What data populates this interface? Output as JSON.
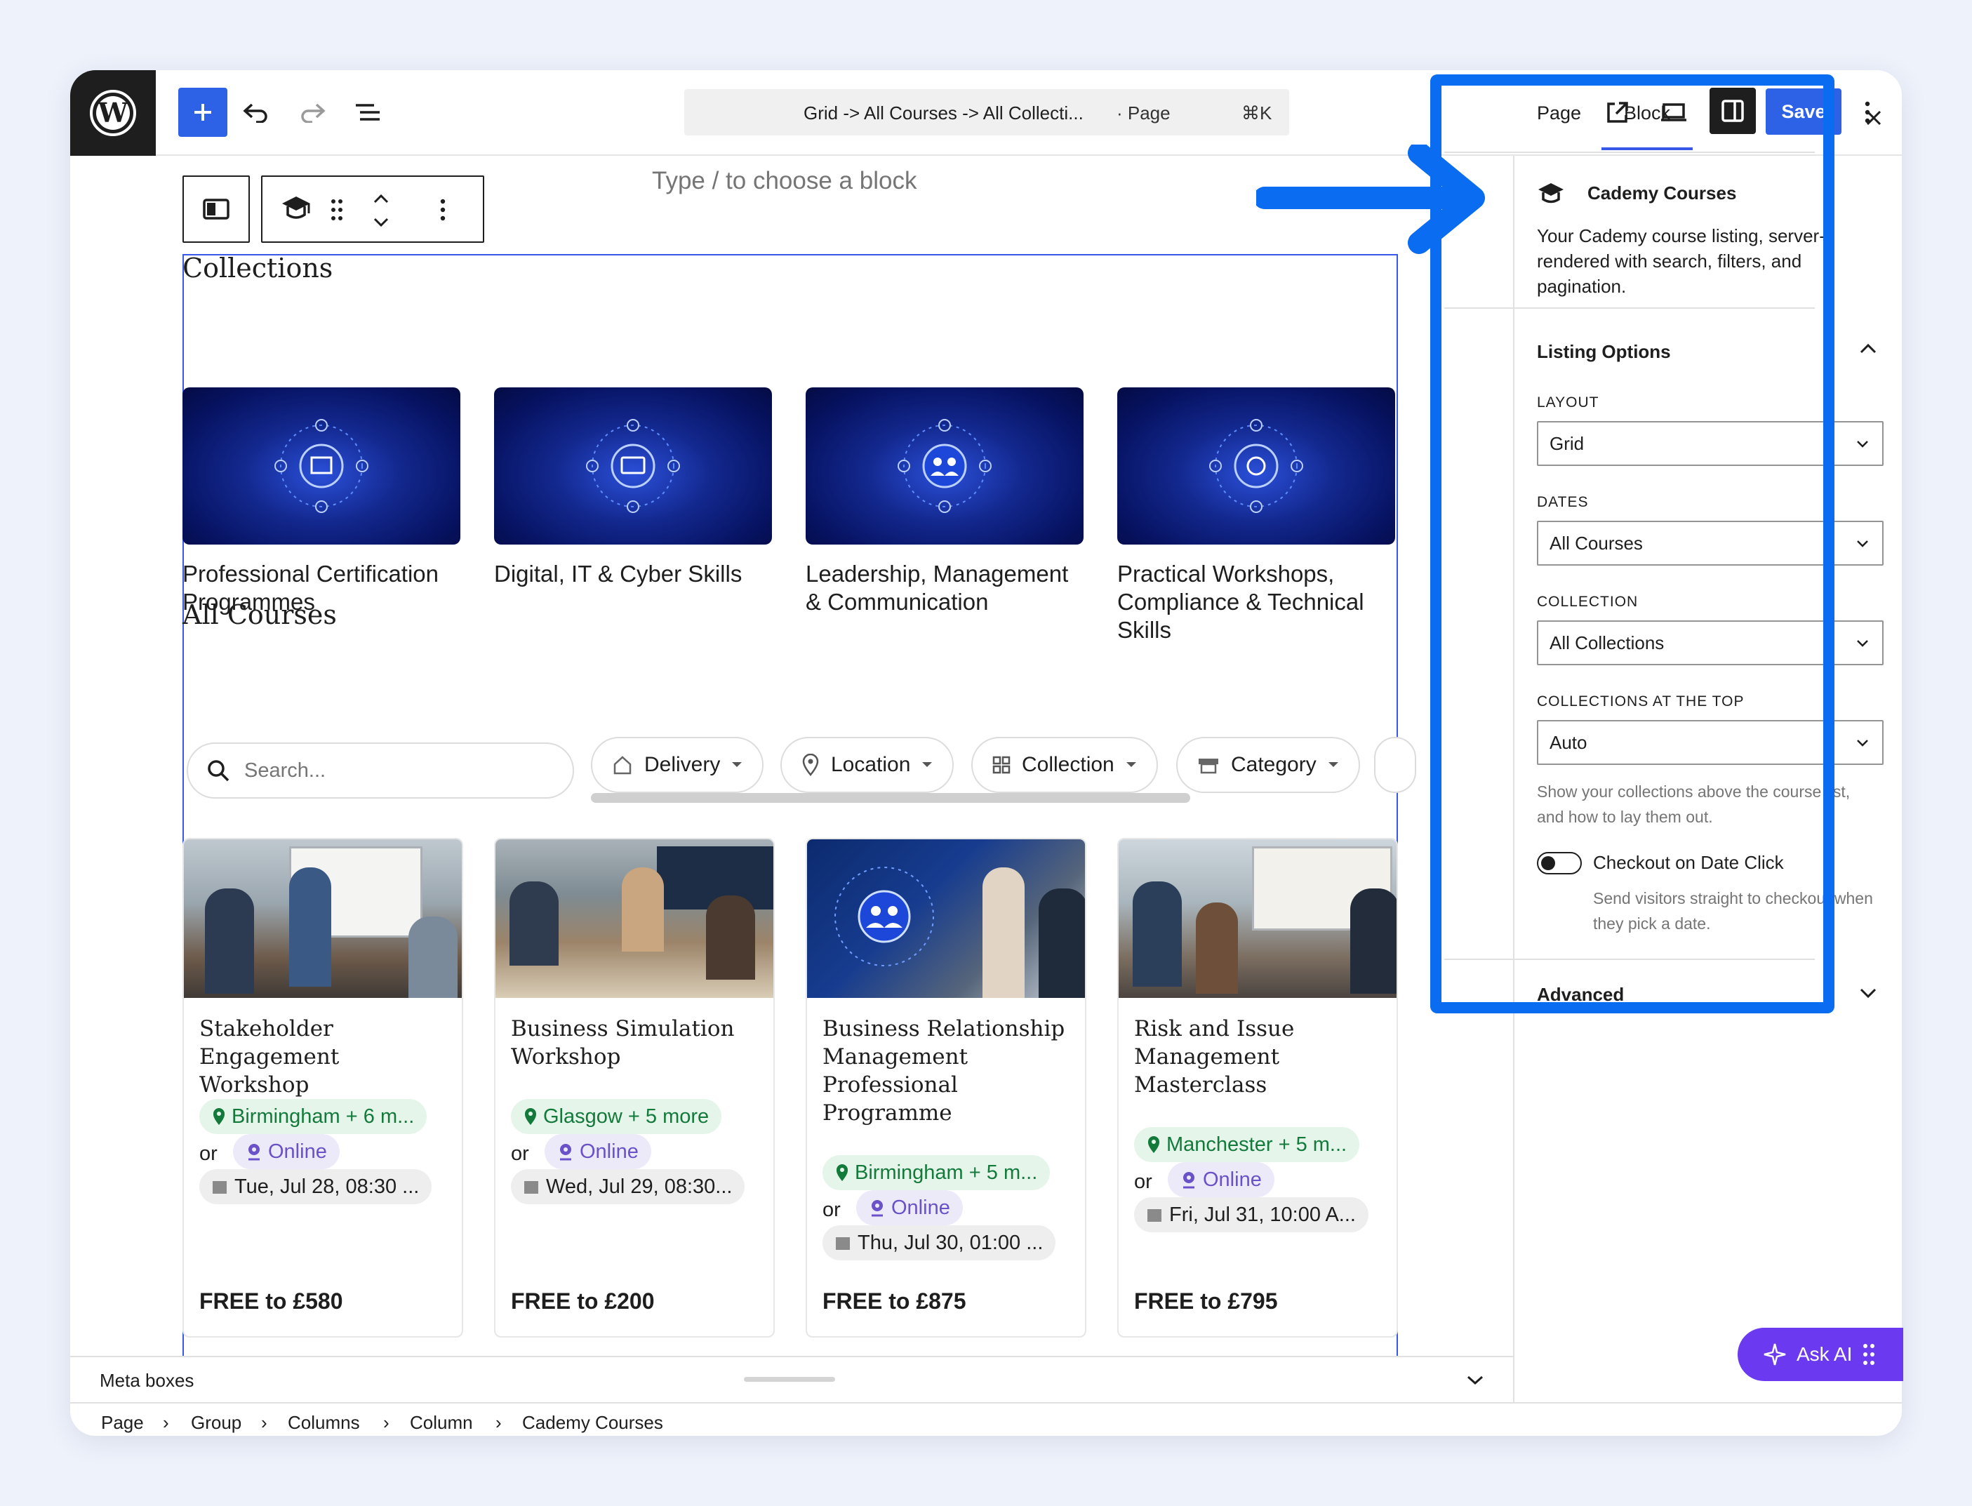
{
  "toolbar": {
    "command_bar_title": "Grid -> All Courses -> All Collecti...",
    "command_bar_type": "· Page",
    "command_bar_shortcut": "⌘K",
    "save_label": "Save"
  },
  "editor": {
    "placeholder": "Type / to choose a block",
    "collections_heading": "Collections",
    "all_courses_heading": "All Courses",
    "search_placeholder": "Search...",
    "filters": [
      "Delivery",
      "Location",
      "Collection",
      "Category"
    ]
  },
  "collections": [
    {
      "title": "Professional Certification Programmes"
    },
    {
      "title": "Digital, IT & Cyber Skills"
    },
    {
      "title": "Leadership, Management & Communication"
    },
    {
      "title": "Practical Workshops, Compliance & Technical Skills"
    }
  ],
  "courses": [
    {
      "title": "Stakeholder Engagement Workshop",
      "location": "Birmingham + 6 m...",
      "or": "or",
      "online": "Online",
      "date": "Tue, Jul 28, 08:30 ...",
      "price": "FREE to £580"
    },
    {
      "title": "Business Simulation Workshop",
      "location": "Glasgow + 5 more",
      "or": "or",
      "online": "Online",
      "date": "Wed, Jul 29, 08:30...",
      "price": "FREE to £200"
    },
    {
      "title": "Business Relationship Management Professional Programme",
      "location": "Birmingham + 5 m...",
      "or": "or",
      "online": "Online",
      "date": "Thu, Jul 30, 01:00 ...",
      "price": "FREE to £875"
    },
    {
      "title": "Risk and Issue Management Masterclass",
      "location": "Manchester + 5 m...",
      "or": "or",
      "online": "Online",
      "date": "Fri, Jul 31, 10:00 A...",
      "price": "FREE to £795"
    }
  ],
  "footer": {
    "meta_boxes": "Meta boxes",
    "breadcrumb": [
      "Page",
      "Group",
      "Columns",
      "Column",
      "Cademy Courses"
    ]
  },
  "sidebar": {
    "tabs": [
      "Page",
      "Block"
    ],
    "active_tab": "Block",
    "block_name": "Cademy Courses",
    "block_description": "Your Cademy course listing, server-rendered with search, filters, and pagination.",
    "listing_options": "Listing Options",
    "layout_label": "LAYOUT",
    "layout_value": "Grid",
    "dates_label": "DATES",
    "dates_value": "All Courses",
    "collection_label": "COLLECTION",
    "collection_value": "All Collections",
    "collections_top_label": "COLLECTIONS AT THE TOP",
    "collections_top_value": "Auto",
    "collections_top_help": "Show your collections above the course list, and how to lay them out.",
    "checkout_label": "Checkout on Date Click",
    "checkout_help": "Send visitors straight to checkout when they pick a date.",
    "checkout_enabled": false,
    "advanced": "Advanced"
  },
  "ask_ai": "Ask AI",
  "colors": {
    "accent": "#2e62e6",
    "highlight": "#0a6cf0",
    "ask_ai": "#6b3af0",
    "location_green": "#137a3c",
    "online_purple": "#6a51c9"
  }
}
